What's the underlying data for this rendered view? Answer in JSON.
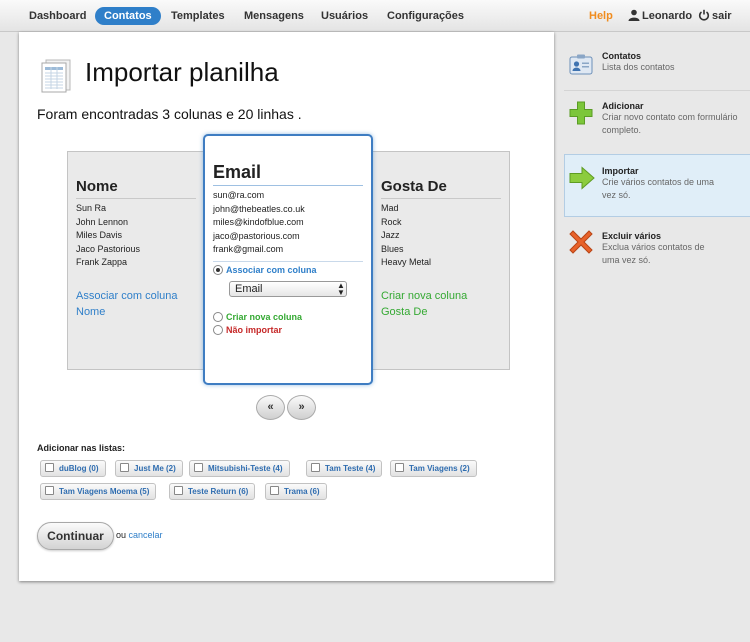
{
  "nav": {
    "items": [
      {
        "label": "Dashboard",
        "active": false
      },
      {
        "label": "Contatos",
        "active": true
      },
      {
        "label": "Templates",
        "active": false
      },
      {
        "label": "Mensagens",
        "active": false
      },
      {
        "label": "Usuários",
        "active": false
      },
      {
        "label": "Configurações",
        "active": false
      }
    ],
    "help": "Help",
    "user": "Leonardo",
    "logout": "sair"
  },
  "page": {
    "title": "Importar planilha",
    "found": "Foram encontradas 3 colunas e 20 linhas ."
  },
  "columns": {
    "left": {
      "title": "Nome",
      "rows": [
        "Sun Ra",
        "John Lennon",
        "Miles Davis",
        "Jaco Pastorious",
        "Frank Zappa"
      ],
      "assoc_line1": "Associar com coluna",
      "assoc_line2": "Nome"
    },
    "center": {
      "title": "Email",
      "rows": [
        "sun@ra.com",
        "john@thebeatles.co.uk",
        "miles@kindofblue.com",
        "jaco@pastorious.com",
        "frank@gmail.com"
      ],
      "option_associate": "Associar com coluna",
      "select_value": "Email",
      "option_create": "Criar nova coluna",
      "option_ignore": "Não importar"
    },
    "right": {
      "title": "Gosta De",
      "rows": [
        "Mad",
        "Rock",
        "Jazz",
        "Blues",
        "Heavy Metal"
      ],
      "assoc_line1": "Criar nova coluna",
      "assoc_line2": "Gosta De"
    }
  },
  "pager": {
    "prev": "«",
    "next": "»"
  },
  "lists": {
    "label": "Adicionar nas listas:",
    "items": [
      "duBlog (0)",
      "Just Me (2)",
      "Mitsubishi-Teste (4)",
      "Tam Teste (4)",
      "Tam Viagens (2)",
      "Tam Viagens Moema (5)",
      "Teste Return (6)",
      "Trama (6)"
    ]
  },
  "actions": {
    "continue": "Continuar",
    "or": "ou",
    "cancel": "cancelar"
  },
  "sidebar": {
    "items": [
      {
        "title": "Contatos",
        "desc": "Lista dos contatos",
        "icon": "contact-card-icon"
      },
      {
        "title": "Adicionar",
        "desc": "Criar novo contato com formulário completo.",
        "icon": "plus-icon"
      },
      {
        "title": "Importar",
        "desc": "Crie vários contatos de uma vez só.",
        "icon": "arrow-right-icon",
        "active": true
      },
      {
        "title": "Excluir vários",
        "desc": "Exclua vários contatos de uma vez só.",
        "icon": "x-icon"
      }
    ]
  },
  "colors": {
    "accent": "#2f7fc9",
    "help": "#f08c1e",
    "green": "#35a933",
    "red": "#c62828"
  }
}
